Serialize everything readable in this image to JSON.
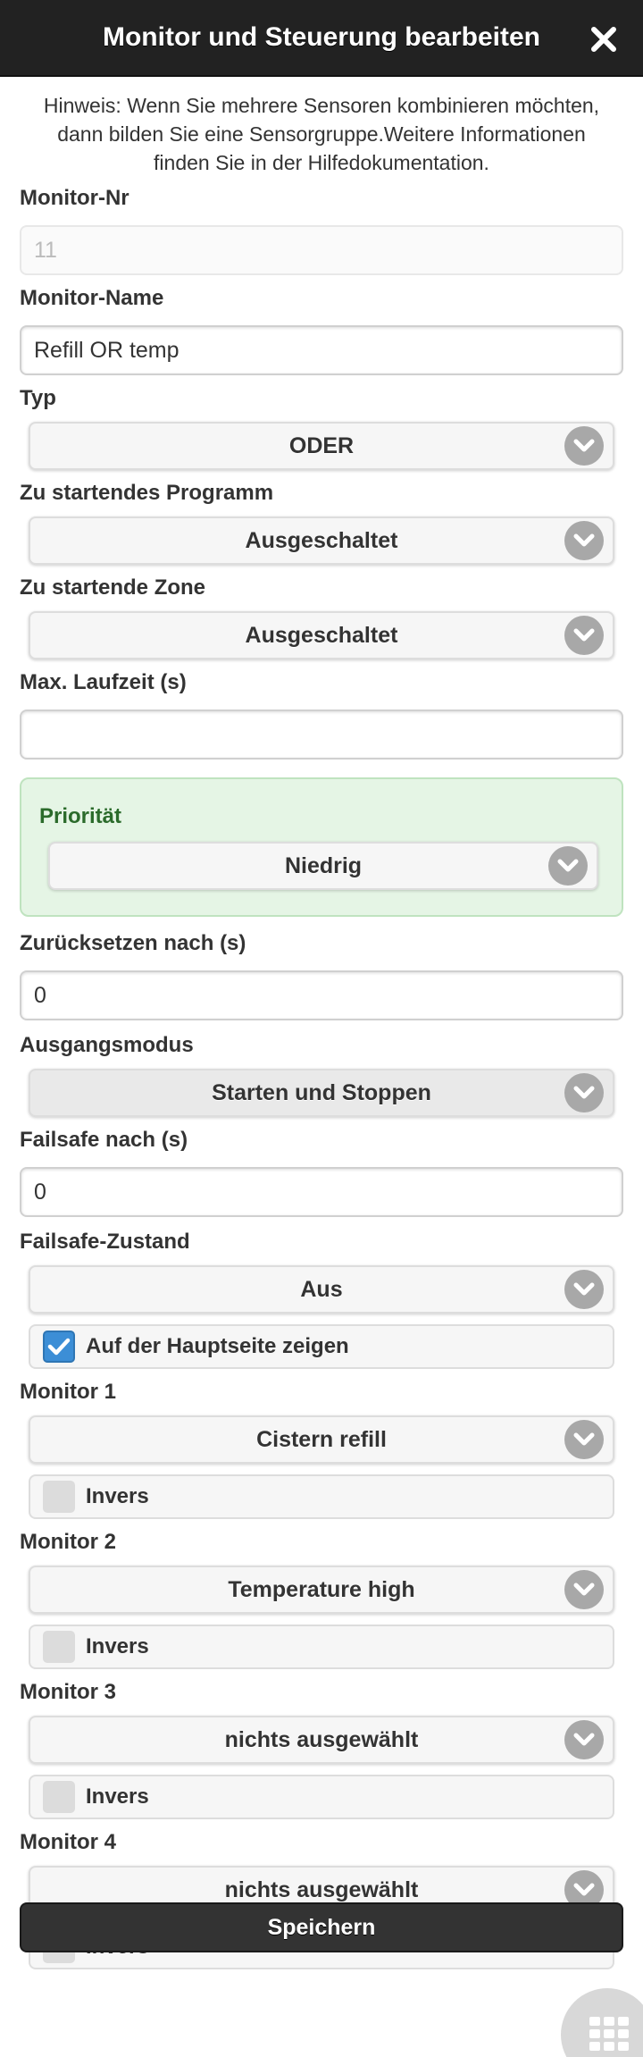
{
  "header": {
    "title": "Monitor und Steuerung bearbeiten"
  },
  "hint": "Hinweis: Wenn Sie mehrere Sensoren kombinieren möchten, dann bilden Sie eine Sensorgruppe.Weitere Informationen finden Sie in der Hilfedokumentation.",
  "fields": {
    "monitor_nr": {
      "label": "Monitor-Nr",
      "value": "11"
    },
    "monitor_name": {
      "label": "Monitor-Name",
      "value": "Refill OR temp"
    },
    "typ": {
      "label": "Typ",
      "value": "ODER"
    },
    "program": {
      "label": "Zu startendes Programm",
      "value": "Ausgeschaltet"
    },
    "zone": {
      "label": "Zu startende Zone",
      "value": "Ausgeschaltet"
    },
    "max_runtime": {
      "label": "Max. Laufzeit (s)",
      "value": ""
    },
    "priority": {
      "label": "Priorität",
      "value": "Niedrig"
    },
    "reset_after": {
      "label": "Zurücksetzen nach (s)",
      "value": "0"
    },
    "output_mode": {
      "label": "Ausgangsmodus",
      "value": "Starten und Stoppen"
    },
    "failsafe_after": {
      "label": "Failsafe nach (s)",
      "value": "0"
    },
    "failsafe_state": {
      "label": "Failsafe-Zustand",
      "value": "Aus"
    },
    "show_main": {
      "label": "Auf der Hauptseite zeigen",
      "checked": true
    }
  },
  "monitors": [
    {
      "label": "Monitor 1",
      "value": "Cistern refill",
      "invert_label": "Invers"
    },
    {
      "label": "Monitor 2",
      "value": "Temperature high",
      "invert_label": "Invers"
    },
    {
      "label": "Monitor 3",
      "value": "nichts ausgewählt",
      "invert_label": "Invers"
    },
    {
      "label": "Monitor 4",
      "value": "nichts ausgewählt",
      "invert_label": "Invers"
    }
  ],
  "save_label": "Speichern",
  "colors": {
    "header": "#222222",
    "priority_bg": "#e5f5e5",
    "priority_label": "#2b6b2b",
    "checkbox_checked": "#3c8ed6"
  }
}
